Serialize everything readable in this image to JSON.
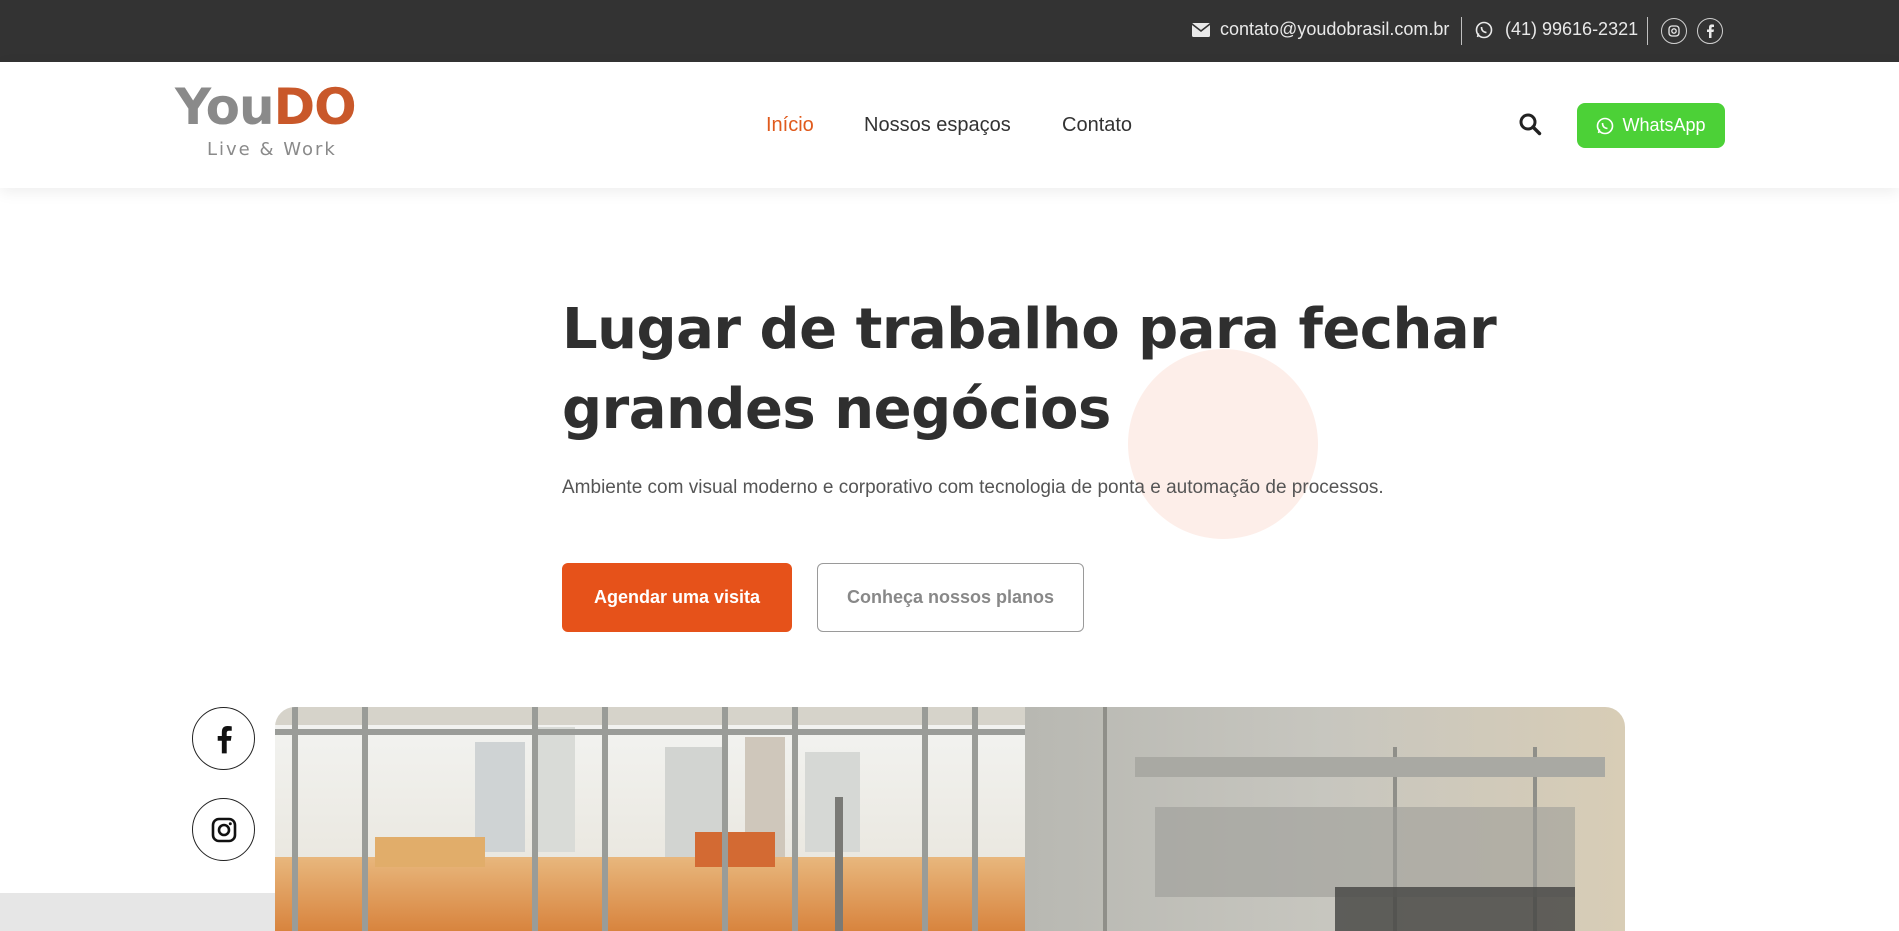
{
  "topbar": {
    "email": "contato@youdobrasil.com.br",
    "phone": "(41) 99616-2321",
    "icons": [
      "envelope-icon",
      "whatsapp-icon",
      "instagram-icon",
      "facebook-icon"
    ]
  },
  "header": {
    "logo": {
      "you": "You",
      "do": "DO",
      "tagline": "Live & Work"
    },
    "nav": [
      {
        "label": "Início",
        "active": true
      },
      {
        "label": "Nossos espaços",
        "active": false
      },
      {
        "label": "Contato",
        "active": false
      }
    ],
    "whatsapp_label": "WhatsApp"
  },
  "hero": {
    "title": "Lugar de trabalho para fechar grandes negócios",
    "subtitle": "Ambiente com visual moderno e corporativo com tecnologia de ponta e automação de processos.",
    "primary_button": "Agendar uma visita",
    "secondary_button": "Conheça nossos planos"
  },
  "colors": {
    "topbar_bg": "#333333",
    "accent": "#e6521a",
    "whatsapp": "#4cd137",
    "blob": "#fdeee9"
  }
}
